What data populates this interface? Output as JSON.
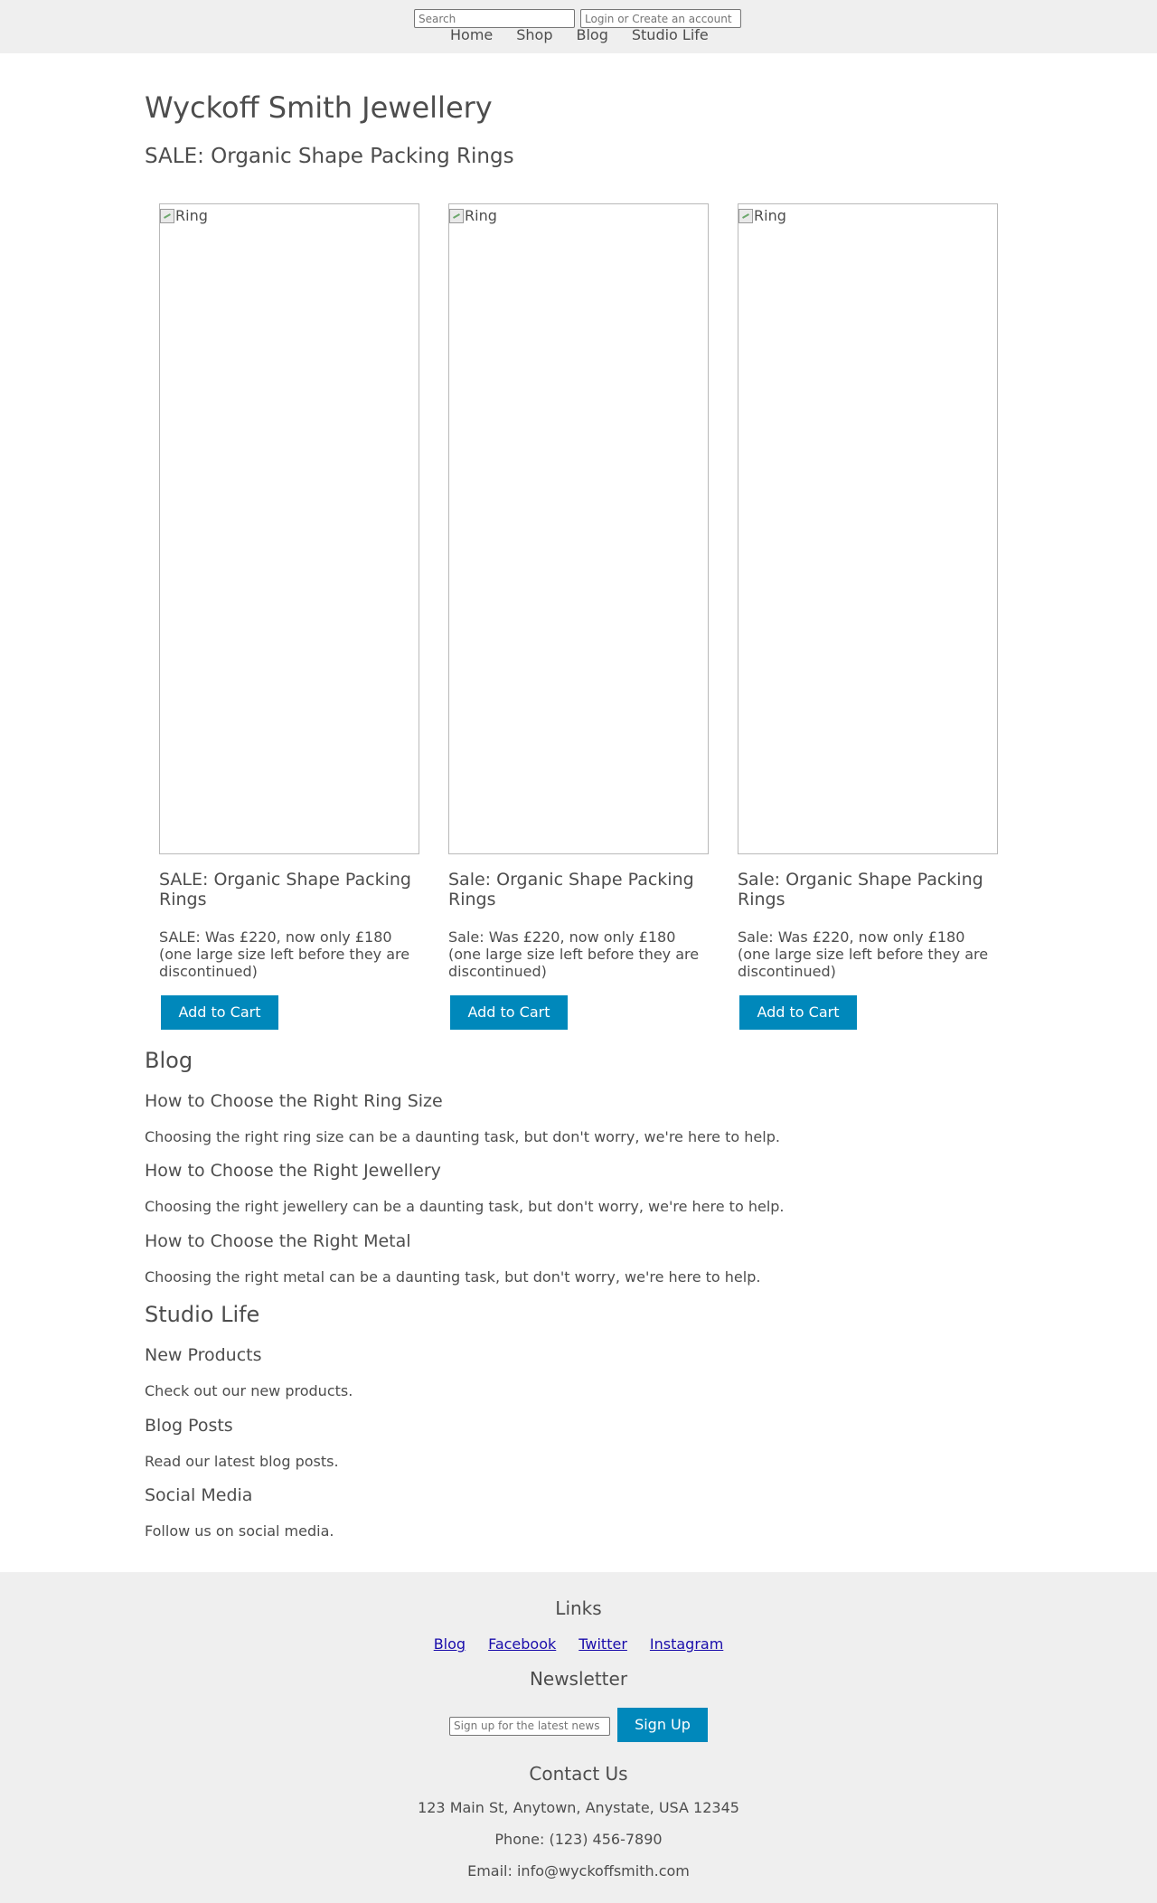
{
  "header": {
    "search_placeholder": "Search",
    "login_placeholder": "Login or Create an account",
    "nav": [
      "Home",
      "Shop",
      "Blog",
      "Studio Life"
    ]
  },
  "site": {
    "title": "Wyckoff Smith Jewellery",
    "sale_heading": "SALE: Organic Shape Packing Rings"
  },
  "products": [
    {
      "image_alt": "Ring",
      "title": "SALE: Organic Shape Packing Rings",
      "description": "SALE: Was £220, now only £180 (one large size left before they are discontinued)",
      "button": "Add to Cart"
    },
    {
      "image_alt": "Ring",
      "title": "Sale: Organic Shape Packing Rings",
      "description": "Sale: Was £220, now only £180 (one large size left before they are discontinued)",
      "button": "Add to Cart"
    },
    {
      "image_alt": "Ring",
      "title": "Sale: Organic Shape Packing Rings",
      "description": "Sale: Was £220, now only £180 (one large size left before they are discontinued)",
      "button": "Add to Cart"
    }
  ],
  "blog": {
    "title": "Blog",
    "posts": [
      {
        "title": "How to Choose the Right Ring Size",
        "text": "Choosing the right ring size can be a daunting task, but don't worry, we're here to help."
      },
      {
        "title": "How to Choose the Right Jewellery",
        "text": "Choosing the right jewellery can be a daunting task, but don't worry, we're here to help."
      },
      {
        "title": "How to Choose the Right Metal",
        "text": "Choosing the right metal can be a daunting task, but don't worry, we're here to help."
      }
    ]
  },
  "studio": {
    "title": "Studio Life",
    "posts": [
      {
        "title": "New Products",
        "text": "Check out our new products."
      },
      {
        "title": "Blog Posts",
        "text": "Read our latest blog posts."
      },
      {
        "title": "Social Media",
        "text": "Follow us on social media."
      }
    ]
  },
  "footer": {
    "links_title": "Links",
    "links": [
      "Blog",
      "Facebook",
      "Twitter",
      "Instagram"
    ],
    "newsletter_title": "Newsletter",
    "newsletter_placeholder": "Sign up for the latest news",
    "signup_button": "Sign Up",
    "contact_title": "Contact Us",
    "address": "123 Main St, Anytown, Anystate, USA 12345",
    "phone": "Phone: (123) 456-7890",
    "email": "Email: info@wyckoffsmith.com"
  },
  "colors": {
    "accent": "#0088bb",
    "header_bg": "#efefef",
    "text": "#4d4d4d",
    "link": "#1a0dab"
  }
}
